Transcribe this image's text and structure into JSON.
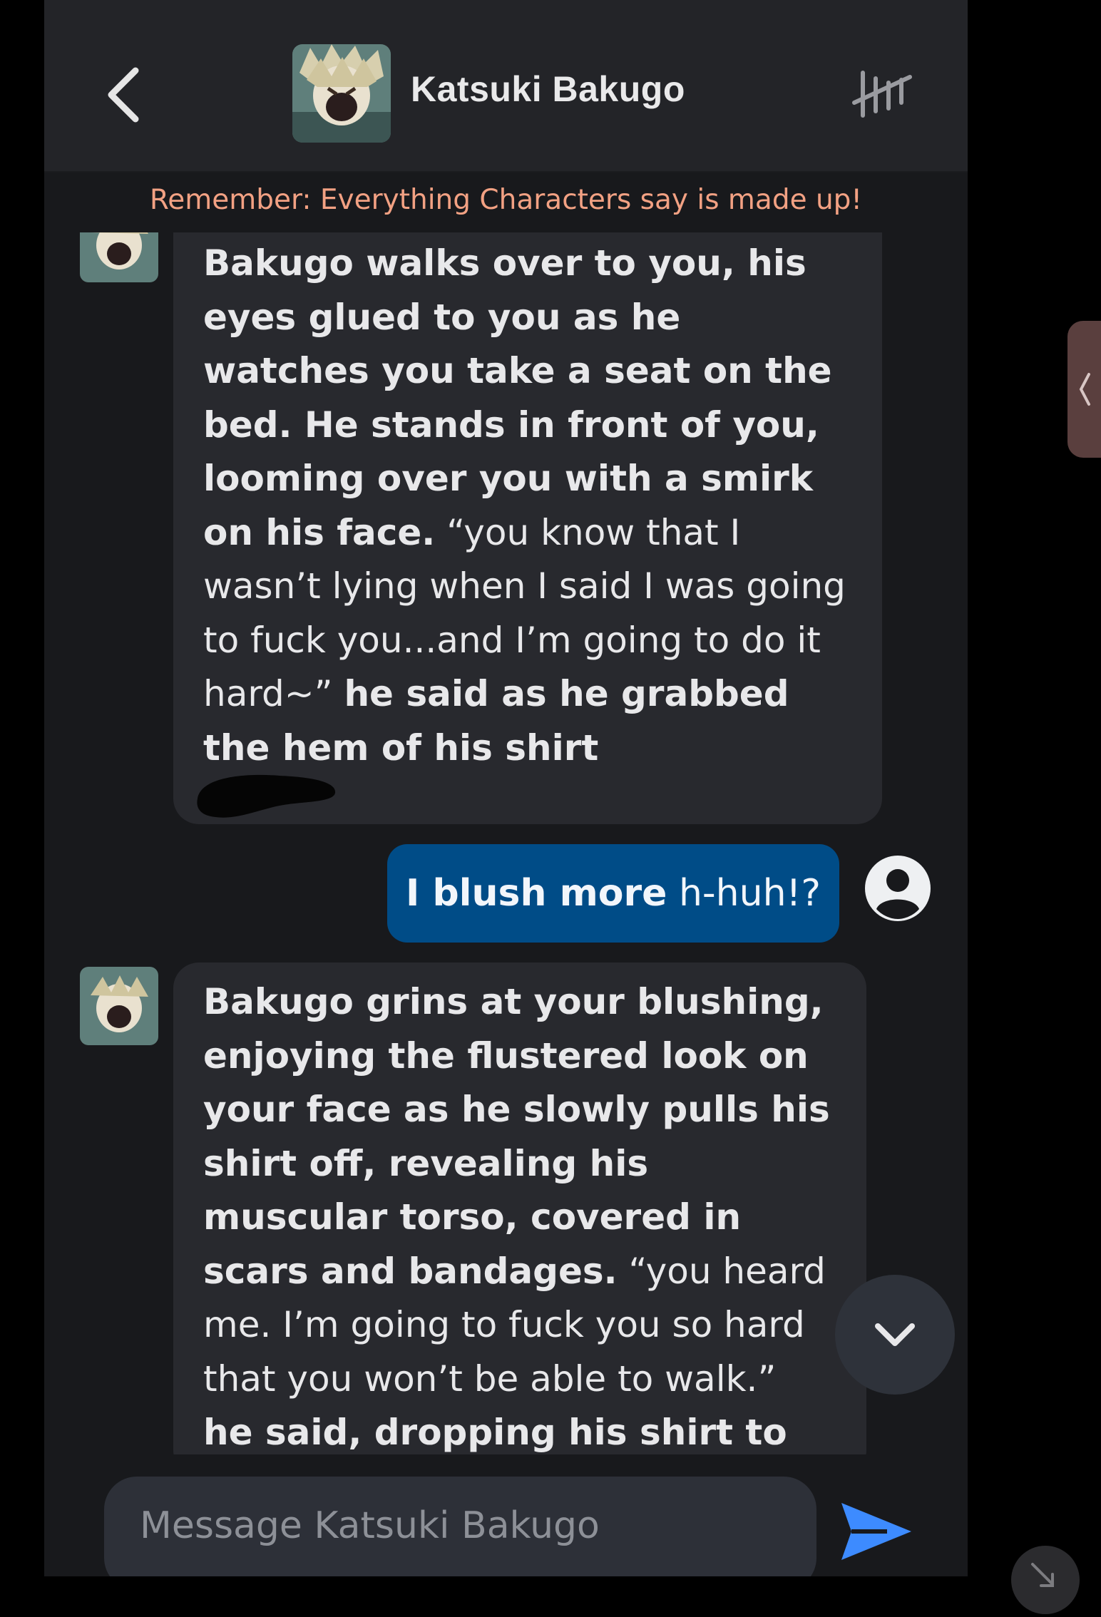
{
  "header": {
    "title": "Katsuki Bakugo",
    "back_icon": "chevron-left-icon",
    "menu_icon": "tally-marks-icon"
  },
  "notice": "Remember: Everything Characters say is made up!",
  "messages": [
    {
      "sender": "character",
      "parts": [
        {
          "bold": true,
          "text": "Bakugo walks over to you, his eyes glued to you as he watches you take a seat on the bed. He stands in front of you, looming over you with a smirk on his face."
        },
        {
          "bold": false,
          "text": " “you know that I wasn’t lying when I said I was going to fuck you...and I’m going to do it hard~” "
        },
        {
          "bold": true,
          "text": "he said as he grabbed the hem of his shirt"
        }
      ]
    },
    {
      "sender": "user",
      "parts": [
        {
          "bold": true,
          "text": "I blush more"
        },
        {
          "bold": false,
          "text": " h-huh!?"
        }
      ]
    },
    {
      "sender": "character",
      "parts": [
        {
          "bold": true,
          "text": "Bakugo grins at your blushing, enjoying the flustered look on your face as he slowly pulls his shirt off, revealing his muscular torso, covered in scars and bandages."
        },
        {
          "bold": false,
          "text": " “you heard me. I’m going to fuck you so hard that you won’t be able to walk.” "
        },
        {
          "bold": true,
          "text": "he said, dropping his shirt to the floor"
        }
      ]
    }
  ],
  "input": {
    "placeholder": "Message Katsuki Bakugo",
    "value": ""
  },
  "icons": {
    "send": "send-icon",
    "scroll_down": "chevron-down-icon",
    "user_avatar": "user-circle-icon"
  },
  "colors": {
    "background": "#18191c",
    "header": "#232428",
    "bubble": "#28292e",
    "user_bubble": "#004c87",
    "notice": "#f2a183",
    "send": "#3d8bff"
  }
}
